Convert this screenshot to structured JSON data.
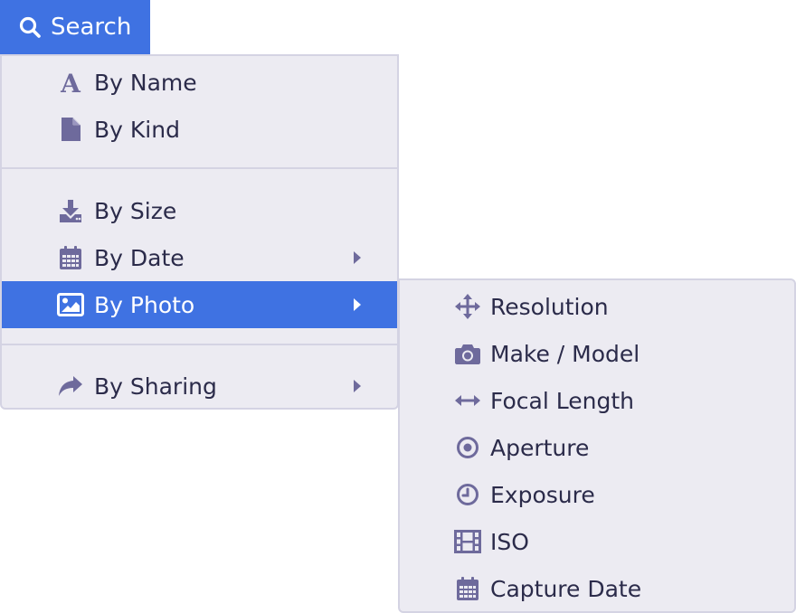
{
  "search_button": {
    "label": "Search",
    "icon": "search-icon"
  },
  "main_menu": {
    "items": [
      {
        "label": "By Name",
        "icon": "font-icon",
        "has_submenu": false
      },
      {
        "label": "By Kind",
        "icon": "file-icon",
        "has_submenu": false
      },
      {
        "label": "By Size",
        "icon": "download-icon",
        "has_submenu": false
      },
      {
        "label": "By Date",
        "icon": "calendar-icon",
        "has_submenu": true
      },
      {
        "label": "By Photo",
        "icon": "image-icon",
        "has_submenu": true,
        "selected": true
      },
      {
        "label": "By Sharing",
        "icon": "share-icon",
        "has_submenu": true
      }
    ]
  },
  "photo_submenu": {
    "items": [
      {
        "label": "Resolution",
        "icon": "move-arrows-icon"
      },
      {
        "label": "Make / Model",
        "icon": "camera-icon"
      },
      {
        "label": "Focal Length",
        "icon": "horizontal-arrows-icon"
      },
      {
        "label": "Aperture",
        "icon": "aperture-icon"
      },
      {
        "label": "Exposure",
        "icon": "clock-icon"
      },
      {
        "label": "ISO",
        "icon": "film-icon"
      },
      {
        "label": "Capture Date",
        "icon": "calendar-icon"
      }
    ]
  },
  "colors": {
    "accent": "#3f72e2",
    "menu_background": "#ecebf2",
    "menu_border": "#d4d3e3",
    "icon": "#6e6a9c",
    "text": "#2b2b4a"
  }
}
